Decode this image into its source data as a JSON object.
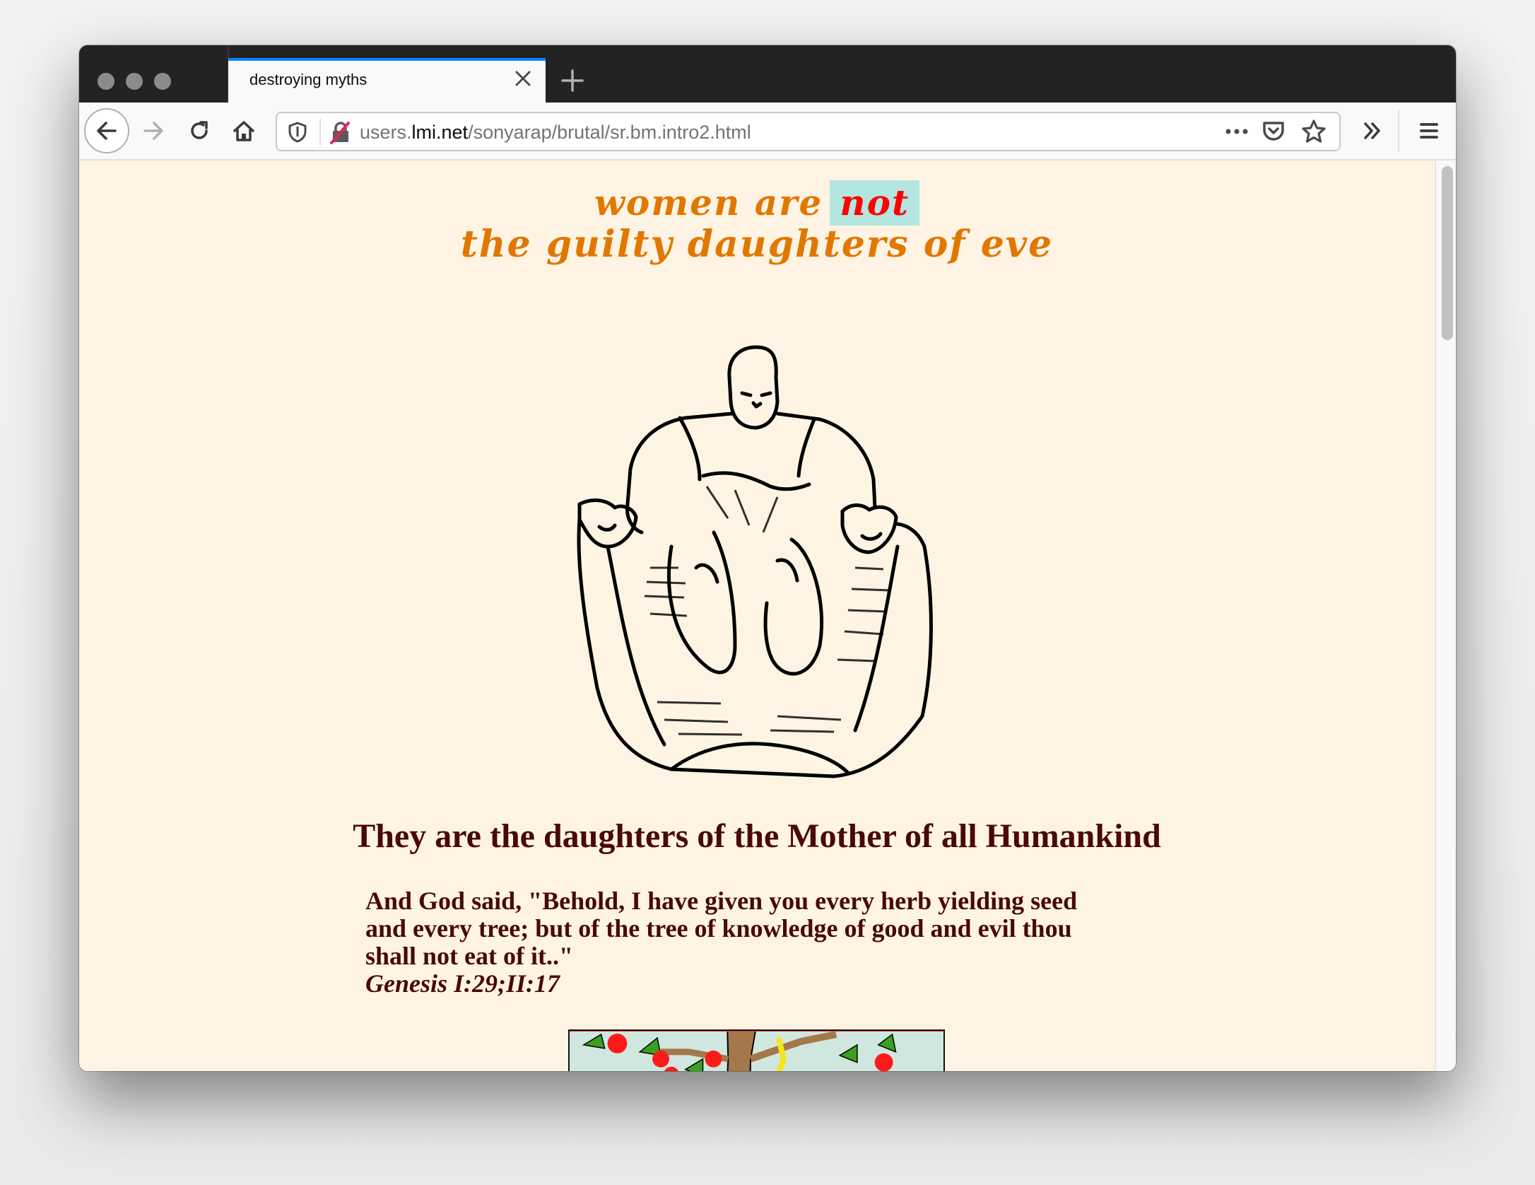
{
  "browser": {
    "tab": {
      "title": "destroying myths"
    },
    "url": {
      "prefix": "users.",
      "host": "lmi.net",
      "path": "/sonyarap/brutal/sr.bm.intro2.html"
    },
    "icons": {
      "back": "back-arrow-icon",
      "forward": "forward-arrow-icon",
      "reload": "reload-icon",
      "home": "home-icon",
      "tracking": "shield-icon",
      "insecure": "insecure-lock-icon",
      "page_actions": "more-horizontal-icon",
      "pocket": "pocket-icon",
      "bookmark": "star-icon",
      "overflow": "chevron-double-right-icon",
      "menu": "hamburger-menu-icon"
    },
    "accent_color": "#0a84ff"
  },
  "page": {
    "banner": {
      "line1_before": "women are",
      "line1_highlight": "not",
      "line2": "the guilty daughters of eve",
      "text_color": "#e07800",
      "highlight_color": "#ff0000",
      "highlight_bg": "#b3e6e0"
    },
    "figure_alt": "seated goddess figure with two felines",
    "heading": "They are the daughters of the Mother of all Humankind",
    "quote": {
      "line1": "And God said, \"Behold, I have given you every herb yielding seed",
      "line2": "and every tree; but of the tree of knowledge of good and evil thou",
      "line3": "shall not eat of it..\"",
      "citation": "Genesis I:29;II:17"
    },
    "eden_image_alt": "Adam and Eve under the tree with apples and serpent",
    "background_color": "#fff4e4",
    "text_color": "#4a0808"
  }
}
